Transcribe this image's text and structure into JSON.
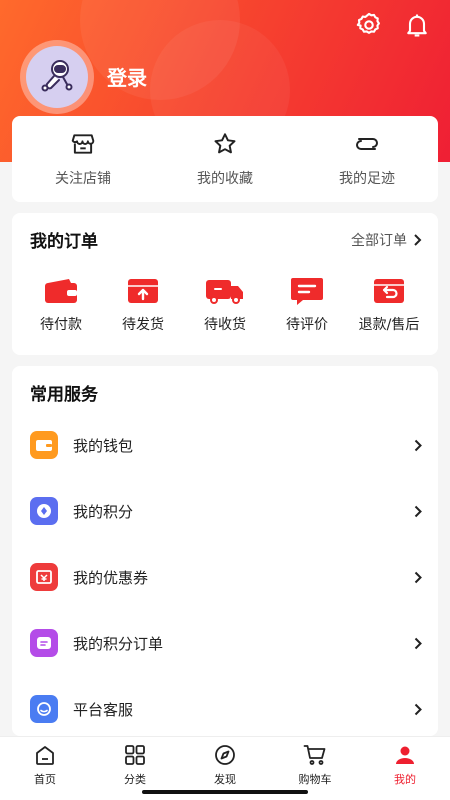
{
  "header": {
    "login_label": "登录",
    "avatar_icon": "astronaut-avatar-icon",
    "settings_icon": "gear-icon",
    "notifications_icon": "bell-icon"
  },
  "quick_links": [
    {
      "label": "关注店铺",
      "icon": "store-icon"
    },
    {
      "label": "我的收藏",
      "icon": "star-icon"
    },
    {
      "label": "我的足迹",
      "icon": "footprint-icon"
    }
  ],
  "orders": {
    "title": "我的订单",
    "all_label": "全部订单",
    "items": [
      {
        "label": "待付款",
        "icon": "wallet-icon"
      },
      {
        "label": "待发货",
        "icon": "upload-box-icon"
      },
      {
        "label": "待收货",
        "icon": "truck-icon"
      },
      {
        "label": "待评价",
        "icon": "comment-icon"
      },
      {
        "label": "退款/售后",
        "icon": "return-icon"
      }
    ]
  },
  "services": {
    "title": "常用服务",
    "items": [
      {
        "label": "我的钱包",
        "icon": "wallet-icon",
        "color": "#ff9a1f"
      },
      {
        "label": "我的积分",
        "icon": "points-icon",
        "color": "#5b6ef0"
      },
      {
        "label": "我的优惠券",
        "icon": "coupon-icon",
        "color": "#ee3b3b"
      },
      {
        "label": "我的积分订单",
        "icon": "points-order-icon",
        "color": "#b44ce8"
      },
      {
        "label": "平台客服",
        "icon": "customer-service-icon",
        "color": "#4a7cf2"
      }
    ]
  },
  "tabbar": [
    {
      "label": "首页",
      "icon": "home-icon"
    },
    {
      "label": "分类",
      "icon": "grid-icon"
    },
    {
      "label": "发现",
      "icon": "compass-icon"
    },
    {
      "label": "购物车",
      "icon": "cart-icon"
    },
    {
      "label": "我的",
      "icon": "user-icon",
      "active": true
    }
  ],
  "colors": {
    "accent": "#ee1f2f",
    "hero_gradient_start": "#ff6a2c",
    "hero_gradient_end": "#ef1f34"
  }
}
